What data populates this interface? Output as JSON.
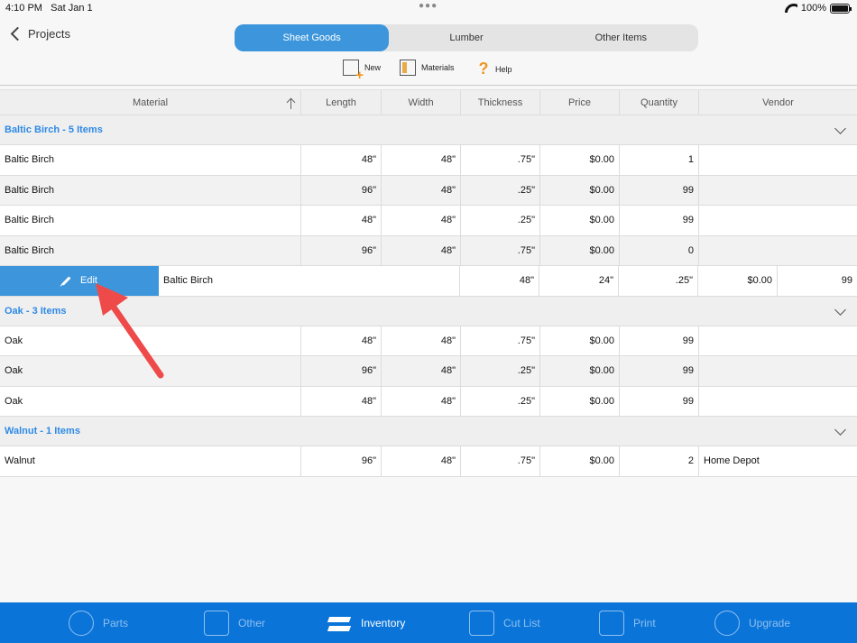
{
  "status": {
    "time": "4:10 PM",
    "date": "Sat Jan 1",
    "battery": "100%"
  },
  "header": {
    "back_label": "Projects",
    "tabs": [
      {
        "label": "Sheet Goods",
        "active": true
      },
      {
        "label": "Lumber",
        "active": false
      },
      {
        "label": "Other Items",
        "active": false
      }
    ]
  },
  "toolbar": {
    "new_label": "New",
    "materials_label": "Materials",
    "help_label": "Help"
  },
  "table": {
    "columns": [
      "Material",
      "Length",
      "Width",
      "Thickness",
      "Price",
      "Quantity",
      "Vendor"
    ],
    "groups": [
      {
        "title": "Baltic Birch - 5 Items",
        "rows": [
          {
            "material": "Baltic Birch",
            "length": "48\"",
            "width": "48\"",
            "thickness": ".75\"",
            "price": "$0.00",
            "quantity": "1",
            "vendor": ""
          },
          {
            "material": "Baltic Birch",
            "length": "96\"",
            "width": "48\"",
            "thickness": ".25\"",
            "price": "$0.00",
            "quantity": "99",
            "vendor": ""
          },
          {
            "material": "Baltic Birch",
            "length": "48\"",
            "width": "48\"",
            "thickness": ".25\"",
            "price": "$0.00",
            "quantity": "99",
            "vendor": ""
          },
          {
            "material": "Baltic Birch",
            "length": "96\"",
            "width": "48\"",
            "thickness": ".75\"",
            "price": "$0.00",
            "quantity": "0",
            "vendor": ""
          }
        ],
        "swiped_row": {
          "edit_label": "Edit",
          "material": "Baltic Birch",
          "length": "48\"",
          "width": "24\"",
          "thickness": ".25\"",
          "price": "$0.00",
          "quantity": "99"
        }
      },
      {
        "title": "Oak - 3 Items",
        "rows": [
          {
            "material": "Oak",
            "length": "48\"",
            "width": "48\"",
            "thickness": ".75\"",
            "price": "$0.00",
            "quantity": "99",
            "vendor": ""
          },
          {
            "material": "Oak",
            "length": "96\"",
            "width": "48\"",
            "thickness": ".25\"",
            "price": "$0.00",
            "quantity": "99",
            "vendor": ""
          },
          {
            "material": "Oak",
            "length": "48\"",
            "width": "48\"",
            "thickness": ".25\"",
            "price": "$0.00",
            "quantity": "99",
            "vendor": ""
          }
        ]
      },
      {
        "title": "Walnut - 1 Items",
        "rows": [
          {
            "material": "Walnut",
            "length": "96\"",
            "width": "48\"",
            "thickness": ".75\"",
            "price": "$0.00",
            "quantity": "2",
            "vendor": "Home Depot"
          }
        ]
      }
    ]
  },
  "tabbar": {
    "items": [
      {
        "label": "Parts",
        "icon": "tape-measure-icon",
        "active": false
      },
      {
        "label": "Other",
        "icon": "other-items-icon",
        "active": false
      },
      {
        "label": "Inventory",
        "icon": "layers-icon",
        "active": true
      },
      {
        "label": "Cut List",
        "icon": "cut-list-icon",
        "active": false
      },
      {
        "label": "Print",
        "icon": "print-icon",
        "active": false
      },
      {
        "label": "Upgrade",
        "icon": "upgrade-arrow-icon",
        "active": false
      }
    ]
  },
  "colors": {
    "accent": "#3d96dc",
    "tabbar": "#0a74d9",
    "group_title": "#2e8ae6",
    "annotation_arrow": "#ef4a4a"
  }
}
